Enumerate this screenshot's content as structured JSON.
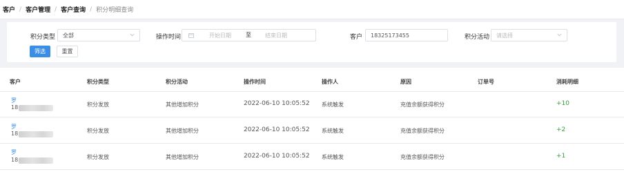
{
  "breadcrumb": {
    "items": [
      "客户",
      "客户管理",
      "客户查询",
      "积分明细查询"
    ],
    "separator": "/"
  },
  "filters": {
    "points_type": {
      "label": "积分类型",
      "value": "全部"
    },
    "operate_time": {
      "label": "操作时间",
      "start_placeholder": "开始日期",
      "range_sep": "至",
      "end_placeholder": "结束日期"
    },
    "customer": {
      "label": "客户",
      "value": "18325173455"
    },
    "activity": {
      "label": "积分活动",
      "placeholder": "请选择"
    },
    "filter_button": "筛选",
    "reset_button": "重置"
  },
  "table": {
    "columns": [
      "客户",
      "积分类型",
      "积分活动",
      "操作时间",
      "操作人",
      "原因",
      "订单号",
      "消耗明细"
    ],
    "rows": [
      {
        "name": "罗",
        "phone_prefix": "18",
        "type": "积分发放",
        "activity": "其他增加积分",
        "time": "2022-06-10 10:05:52",
        "operator": "系统触发",
        "reason": "充值余额获得积分",
        "order": "",
        "detail": "+10"
      },
      {
        "name": "罗",
        "phone_prefix": "18",
        "type": "积分发放",
        "activity": "其他增加积分",
        "time": "2022-06-10 10:05:52",
        "operator": "系统触发",
        "reason": "充值余额获得积分",
        "order": "",
        "detail": "+2"
      },
      {
        "name": "罗",
        "phone_prefix": "18",
        "type": "积分发放",
        "activity": "其他增加积分",
        "time": "2022-06-10 10:05:52",
        "operator": "系统触发",
        "reason": "充值余额获得积分",
        "order": "",
        "detail": "+1"
      }
    ]
  },
  "colors": {
    "primary": "#3a8ee6",
    "positive": "#3c9b3c"
  }
}
